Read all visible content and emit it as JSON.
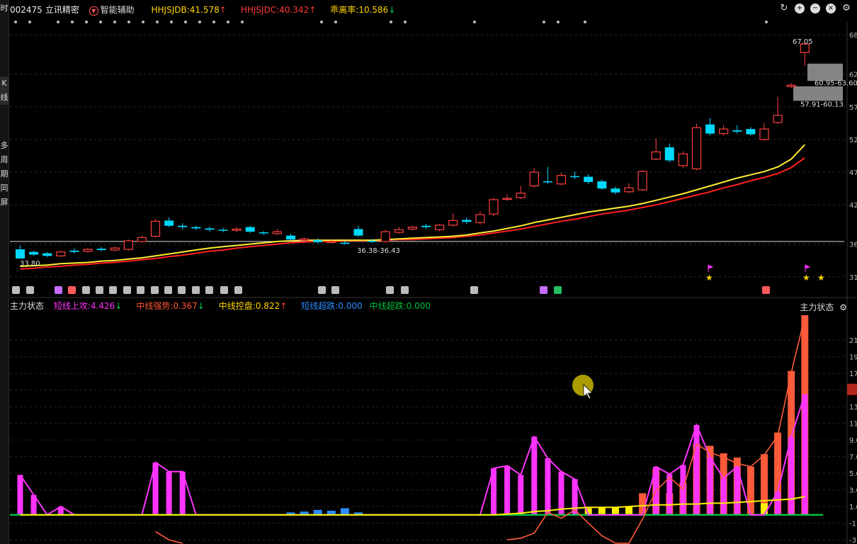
{
  "stock": {
    "code": "002475",
    "name": "立讯精密"
  },
  "left_tabs": [
    "时",
    "K线",
    "多周期同屏"
  ],
  "toolbar": {
    "smart_assist": "智能辅助"
  },
  "indicators_main": [
    {
      "label": "HHJSJDB:41.578",
      "color": "#ffd400",
      "arrow": "up"
    },
    {
      "label": "HHJSJDC:40.342",
      "color": "#ff3b3b",
      "arrow": "up"
    },
    {
      "label": "乖离率:10.586",
      "color": "#ffd400",
      "arrow": "down"
    }
  ],
  "sub_panel": {
    "title": "主力状态",
    "right_title": "主力状态",
    "indicators": [
      {
        "label": "短线上攻:4.426",
        "color": "#ff33ff",
        "arrow": "down"
      },
      {
        "label": "中线强势:0.367",
        "color": "#ff5533",
        "arrow": "down"
      },
      {
        "label": "中线控盘:0.822",
        "color": "#ffd400",
        "arrow": "up"
      },
      {
        "label": "短线超跌:0.000",
        "color": "#2a8cff",
        "arrow": ""
      },
      {
        "label": "中线超跌:0.000",
        "color": "#00c040",
        "arrow": ""
      }
    ]
  },
  "colors": {
    "up": "#ff4040",
    "down": "#00d8ff",
    "ma1": "#ffee33",
    "ma2": "#ff2020",
    "magenta": "#ff33ff",
    "orange": "#ff5a3a",
    "yellow": "#ffee00",
    "blue": "#2a8cff",
    "green": "#00c040"
  },
  "chart_data": [
    {
      "type": "candlestick",
      "ylim": [
        30,
        69
      ],
      "y_ticks": [
        "68",
        "62",
        "57",
        "52",
        "47",
        "42",
        "36",
        "31"
      ],
      "annotations": [
        "67.05",
        "60.95-63.60",
        "57.91-60.13",
        "36.38-36.43",
        "33.80"
      ],
      "candles": [
        [
          35.2,
          33.8,
          35.8,
          33.8
        ],
        [
          34.8,
          34.4,
          35.0,
          34.2
        ],
        [
          34.6,
          34.2,
          34.8,
          34.0
        ],
        [
          34.2,
          34.8,
          35.0,
          34.0
        ],
        [
          35.0,
          34.8,
          35.4,
          34.6
        ],
        [
          34.9,
          35.2,
          35.4,
          34.7
        ],
        [
          35.3,
          35.1,
          35.6,
          34.9
        ],
        [
          35.1,
          35.4,
          35.6,
          34.9
        ],
        [
          35.2,
          36.5,
          36.7,
          35.0
        ],
        [
          36.4,
          37.0,
          37.3,
          36.2
        ],
        [
          37.2,
          39.5,
          39.8,
          37.0
        ],
        [
          39.6,
          38.8,
          40.1,
          38.6
        ],
        [
          38.8,
          38.6,
          39.2,
          38.2
        ],
        [
          38.6,
          38.4,
          38.8,
          38.1
        ],
        [
          38.4,
          38.2,
          38.7,
          37.9
        ],
        [
          38.2,
          38.1,
          38.5,
          37.8
        ],
        [
          38.1,
          38.3,
          38.6,
          37.8
        ],
        [
          38.6,
          37.9,
          38.8,
          37.7
        ],
        [
          37.8,
          37.7,
          38.0,
          37.4
        ],
        [
          37.6,
          37.9,
          38.3,
          37.4
        ],
        [
          37.3,
          36.7,
          37.6,
          36.5
        ],
        [
          36.6,
          36.8,
          37.0,
          36.3
        ],
        [
          36.6,
          36.3,
          36.9,
          36.1
        ],
        [
          36.3,
          36.4,
          36.7,
          36.1
        ],
        [
          36.2,
          36.1,
          36.5,
          35.9
        ],
        [
          38.3,
          37.3,
          38.8,
          37.1
        ],
        [
          36.5,
          36.4,
          36.8,
          36.2
        ],
        [
          36.4,
          37.9,
          38.2,
          36.2
        ],
        [
          37.8,
          38.2,
          38.6,
          37.6
        ],
        [
          38.3,
          38.6,
          38.8,
          38.1
        ],
        [
          38.8,
          38.6,
          39.1,
          38.3
        ],
        [
          38.2,
          38.9,
          39.1,
          38.0
        ],
        [
          38.9,
          39.6,
          40.7,
          38.7
        ],
        [
          39.7,
          39.4,
          40.1,
          39.1
        ],
        [
          39.3,
          40.5,
          41.0,
          39.0
        ],
        [
          40.6,
          42.8,
          43.1,
          40.3
        ],
        [
          42.9,
          43.0,
          43.6,
          42.6
        ],
        [
          43.1,
          43.8,
          44.9,
          42.9
        ],
        [
          44.9,
          47.0,
          47.6,
          44.7
        ],
        [
          45.6,
          45.5,
          47.8,
          45.2
        ],
        [
          45.2,
          46.5,
          46.9,
          45.0
        ],
        [
          46.4,
          46.3,
          47.1,
          45.9
        ],
        [
          46.3,
          45.5,
          46.7,
          45.2
        ],
        [
          45.6,
          44.5,
          45.9,
          44.3
        ],
        [
          44.5,
          43.9,
          44.8,
          43.6
        ],
        [
          44.0,
          44.6,
          45.3,
          43.8
        ],
        [
          44.3,
          47.1,
          47.3,
          44.1
        ],
        [
          49.0,
          50.1,
          52.2,
          48.8
        ],
        [
          50.8,
          48.8,
          51.4,
          48.5
        ],
        [
          48.0,
          49.8,
          50.2,
          47.6
        ],
        [
          47.5,
          53.8,
          54.4,
          47.3
        ],
        [
          54.3,
          52.9,
          55.3,
          52.6
        ],
        [
          52.9,
          53.6,
          54.2,
          52.6
        ],
        [
          53.4,
          53.2,
          54.2,
          52.9
        ],
        [
          53.6,
          52.8,
          53.9,
          52.6
        ],
        [
          52.0,
          53.6,
          54.5,
          51.8
        ],
        [
          54.6,
          55.7,
          58.5,
          54.4
        ],
        [
          60.1,
          60.3,
          60.6,
          59.9
        ],
        [
          65.3,
          66.6,
          67.05,
          63.3
        ]
      ],
      "ma1": [
        32.6,
        32.7,
        32.8,
        33.0,
        33.1,
        33.2,
        33.4,
        33.5,
        33.7,
        33.9,
        34.2,
        34.5,
        34.8,
        35.1,
        35.4,
        35.6,
        35.8,
        36.0,
        36.2,
        36.4,
        36.5,
        36.6,
        36.6,
        36.6,
        36.6,
        36.6,
        36.6,
        36.7,
        36.8,
        36.9,
        37.0,
        37.1,
        37.2,
        37.4,
        37.7,
        38.0,
        38.4,
        38.8,
        39.3,
        39.7,
        40.1,
        40.5,
        40.9,
        41.2,
        41.5,
        41.8,
        42.2,
        42.7,
        43.2,
        43.7,
        44.3,
        44.9,
        45.5,
        46.1,
        46.6,
        47.1,
        47.8,
        49.0,
        51.2
      ],
      "ma2": [
        32.2,
        32.3,
        32.5,
        32.6,
        32.8,
        32.9,
        33.1,
        33.2,
        33.4,
        33.6,
        33.8,
        34.1,
        34.3,
        34.6,
        34.9,
        35.1,
        35.4,
        35.6,
        35.8,
        36.0,
        36.2,
        36.3,
        36.4,
        36.4,
        36.5,
        36.5,
        36.5,
        36.6,
        36.7,
        36.7,
        36.8,
        36.9,
        37.0,
        37.2,
        37.4,
        37.7,
        38.0,
        38.3,
        38.7,
        39.1,
        39.5,
        39.8,
        40.2,
        40.6,
        40.9,
        41.2,
        41.6,
        42.0,
        42.5,
        43.0,
        43.5,
        44.0,
        44.6,
        45.1,
        45.7,
        46.2,
        46.8,
        47.7,
        49.2
      ]
    },
    {
      "type": "bar",
      "ylim": [
        -3.5,
        24
      ],
      "y_ticks": [
        "21",
        "19",
        "17",
        "15",
        "13",
        "11",
        "9.0",
        "7.0",
        "5.0",
        "3.0",
        "1.0",
        "-1",
        "-3"
      ],
      "magenta": [
        4.8,
        2.4,
        0,
        1.0,
        0,
        0,
        0,
        0,
        0,
        0,
        6.3,
        5.2,
        5.2,
        0,
        0,
        0,
        0,
        0,
        0,
        0,
        0,
        0,
        0,
        0,
        0,
        0,
        0,
        0,
        0,
        0,
        0,
        0,
        0,
        0,
        0,
        5.6,
        5.9,
        4.8,
        9.4,
        6.8,
        5.2,
        4.3,
        0,
        0,
        0,
        0,
        0,
        5.8,
        4.9,
        6.0,
        10.8,
        6.9,
        4.4,
        5.8,
        0,
        0,
        2.8,
        9.4,
        14.5
      ],
      "orange": [
        0,
        0,
        0,
        0,
        0,
        0,
        0,
        0,
        0,
        0,
        0,
        0,
        0,
        0,
        0,
        0,
        0,
        0,
        0,
        0,
        0,
        0,
        0,
        0,
        0,
        0,
        0,
        0,
        0,
        0,
        0,
        0,
        0,
        0,
        0,
        0,
        0,
        0,
        0,
        0,
        0,
        0,
        0,
        0,
        0,
        0,
        2.6,
        5.5,
        2.6,
        3.9,
        8.6,
        8.3,
        7.4,
        6.9,
        5.8,
        7.3,
        9.9,
        17.3,
        24.0
      ],
      "yellow_bars": [
        0,
        0,
        0,
        0,
        0,
        0,
        0,
        0,
        0,
        0,
        0,
        0,
        0,
        0,
        0,
        0,
        0,
        0,
        0,
        0,
        0,
        0,
        0,
        0,
        0,
        0,
        0,
        0,
        0,
        0,
        0,
        0,
        0,
        0,
        0,
        0,
        0,
        0,
        0,
        0,
        0,
        0,
        0.8,
        0.9,
        0.9,
        1.0,
        0,
        0,
        0,
        0,
        0,
        0,
        0,
        0,
        0,
        1.4,
        0,
        0,
        0
      ],
      "blue": [
        0,
        0,
        0,
        0,
        0,
        0,
        0,
        0,
        0,
        0,
        0,
        0,
        0,
        0,
        0,
        0,
        0,
        0,
        0,
        0,
        0.3,
        0.4,
        0.6,
        0.5,
        0.8,
        0.3,
        0,
        0,
        0,
        0,
        0,
        0,
        0,
        0,
        0,
        0,
        0,
        0,
        0,
        0,
        0,
        0,
        0,
        0,
        0,
        0,
        0,
        0,
        0,
        0,
        0,
        0,
        0,
        0,
        0,
        0,
        0,
        0,
        0
      ],
      "yellow_line": [
        0,
        0,
        0,
        0,
        0,
        0,
        0,
        0,
        0,
        0,
        0,
        0,
        0,
        0,
        0,
        0,
        0,
        0,
        0,
        0,
        0,
        0,
        0,
        0,
        0,
        0,
        0,
        0,
        0,
        0,
        0,
        0,
        0,
        0,
        0,
        0,
        0.1,
        0.2,
        0.4,
        0.5,
        0.7,
        0.8,
        0.9,
        0.9,
        0.9,
        1.0,
        1.1,
        1.2,
        1.2,
        1.3,
        1.3,
        1.4,
        1.4,
        1.5,
        1.6,
        1.7,
        1.8,
        1.9,
        2.2
      ],
      "orange_line": [
        -10,
        -10,
        -10,
        -10,
        -10,
        -10,
        -10,
        -10,
        -10,
        -10,
        -2.0,
        -3.0,
        -3.6,
        -10,
        -10,
        -10,
        -10,
        -10,
        -10,
        -10,
        -10,
        -10,
        -10,
        -10,
        -10,
        -10,
        -10,
        -10,
        -10,
        -10,
        -10,
        -10,
        -10,
        -10,
        -10,
        -10,
        -3.0,
        -2.8,
        -2.2,
        0.3,
        -0.4,
        0.6,
        -1.0,
        -2.5,
        -3.4,
        -3.6,
        -0.5,
        2.9,
        4.5,
        3.1,
        8.5,
        7.5,
        6.9,
        6.2,
        5.8,
        7.2,
        9.5,
        17.1,
        23.8
      ]
    }
  ]
}
